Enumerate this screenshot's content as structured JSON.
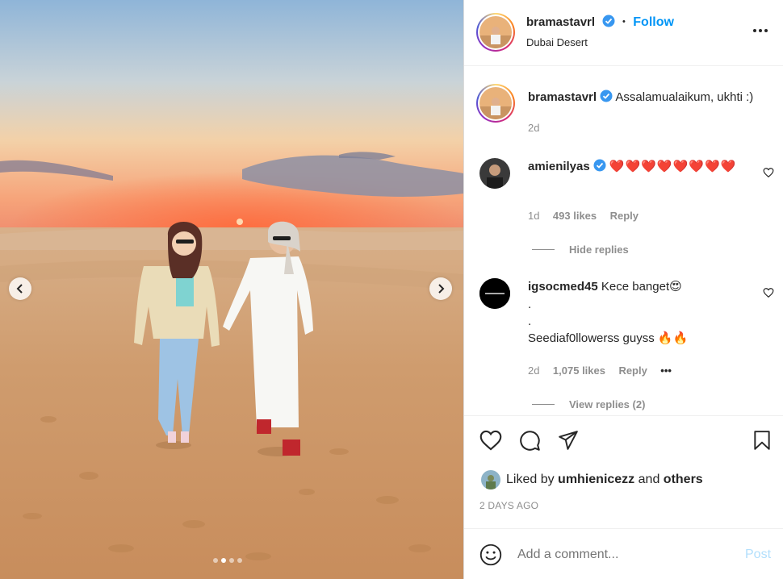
{
  "post": {
    "author": "bramastavrl",
    "location": "Dubai Desert",
    "follow_label": "Follow",
    "separator": "•",
    "more_icon": "more-horizontal-icon",
    "carousel": {
      "total_slides": 4,
      "active_index": 1
    }
  },
  "caption": {
    "username": "bramastavrl",
    "text": "Assalamualaikum, ukhti :)",
    "age": "2d"
  },
  "comments": [
    {
      "username": "amienilyas",
      "text": "❤️❤️❤️❤️❤️❤️❤️❤️",
      "age": "1d",
      "likes": "493 likes",
      "reply_label": "Reply",
      "replies_toggle": "Hide replies"
    },
    {
      "username": "igsocmed45",
      "text_line1": "Kece banget😍",
      "text_line2": ".",
      "text_line3": ".",
      "text_line4": "Seediaf0llowerss guyss 🔥🔥",
      "age": "2d",
      "likes": "1,075 likes",
      "reply_label": "Reply",
      "more": "•••",
      "replies_toggle": "View replies (2)"
    }
  ],
  "likes": {
    "prefix": "Liked by",
    "user": "umhienicezz",
    "and": "and",
    "others": "others"
  },
  "timestamp": "2 DAYS AGO",
  "add_comment": {
    "placeholder": "Add a comment...",
    "post_label": "Post"
  },
  "colors": {
    "accent": "#0095f6",
    "verified": "#3897f0",
    "post_disabled": "#b2dffc"
  }
}
